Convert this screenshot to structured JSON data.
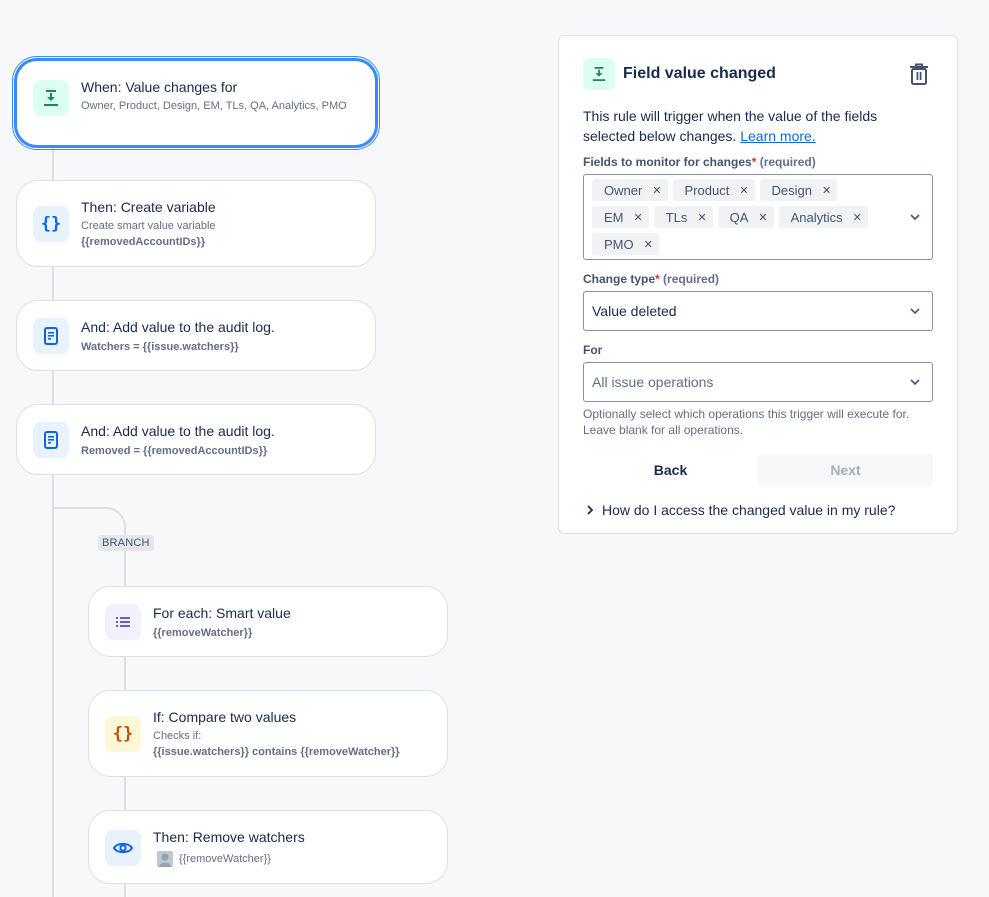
{
  "flow": {
    "branch_label": "BRANCH",
    "steps": [
      {
        "title": "When: Value changes for",
        "sub": "Owner, Product, Design, EM, TLs, QA, Analytics, PMO",
        "icon": "field-changed-icon"
      },
      {
        "title": "Then: Create variable",
        "sub": "Create smart value variable",
        "sub2": "{{removedAccountIDs}}",
        "icon": "braces-icon"
      },
      {
        "title": "And: Add value to the audit log.",
        "sub": "Watchers = {{issue.watchers}}",
        "icon": "audit-log-icon"
      },
      {
        "title": "And: Add value to the audit log.",
        "sub": "Removed = {{removedAccountIDs}}",
        "icon": "audit-log-icon"
      },
      {
        "title": "For each: Smart value",
        "sub": "{{removeWatcher}}",
        "icon": "list-icon"
      },
      {
        "title": "If: Compare two values",
        "sub": "Checks if:",
        "sub2": "{{issue.watchers}} contains {{removeWatcher}}",
        "icon": "braces-icon"
      },
      {
        "title": "Then: Remove watchers",
        "sub": "{{removeWatcher}}",
        "icon": "eye-icon"
      }
    ]
  },
  "panel": {
    "title": "Field value changed",
    "description": "This rule will trigger when the value of the fields selected below changes.",
    "learn_more": "Learn more.",
    "fields_label": "Fields to monitor for changes",
    "required_star": "*",
    "required_text": "(required)",
    "fields": [
      "Owner",
      "Product",
      "Design",
      "EM",
      "TLs",
      "QA",
      "Analytics",
      "PMO"
    ],
    "change_type_label": "Change type",
    "change_type_value": "Value deleted",
    "for_label": "For",
    "for_placeholder": "All issue operations",
    "for_help": "Optionally select which operations this trigger will execute for. Leave blank for all operations.",
    "back_label": "Back",
    "next_label": "Next",
    "expander_label": "How do I access the changed value in my rule?"
  },
  "colors": {
    "accent": "#388bff",
    "link": "#0c66e4",
    "trigger_green": "#1f845a",
    "required_red": "#c9372c"
  }
}
